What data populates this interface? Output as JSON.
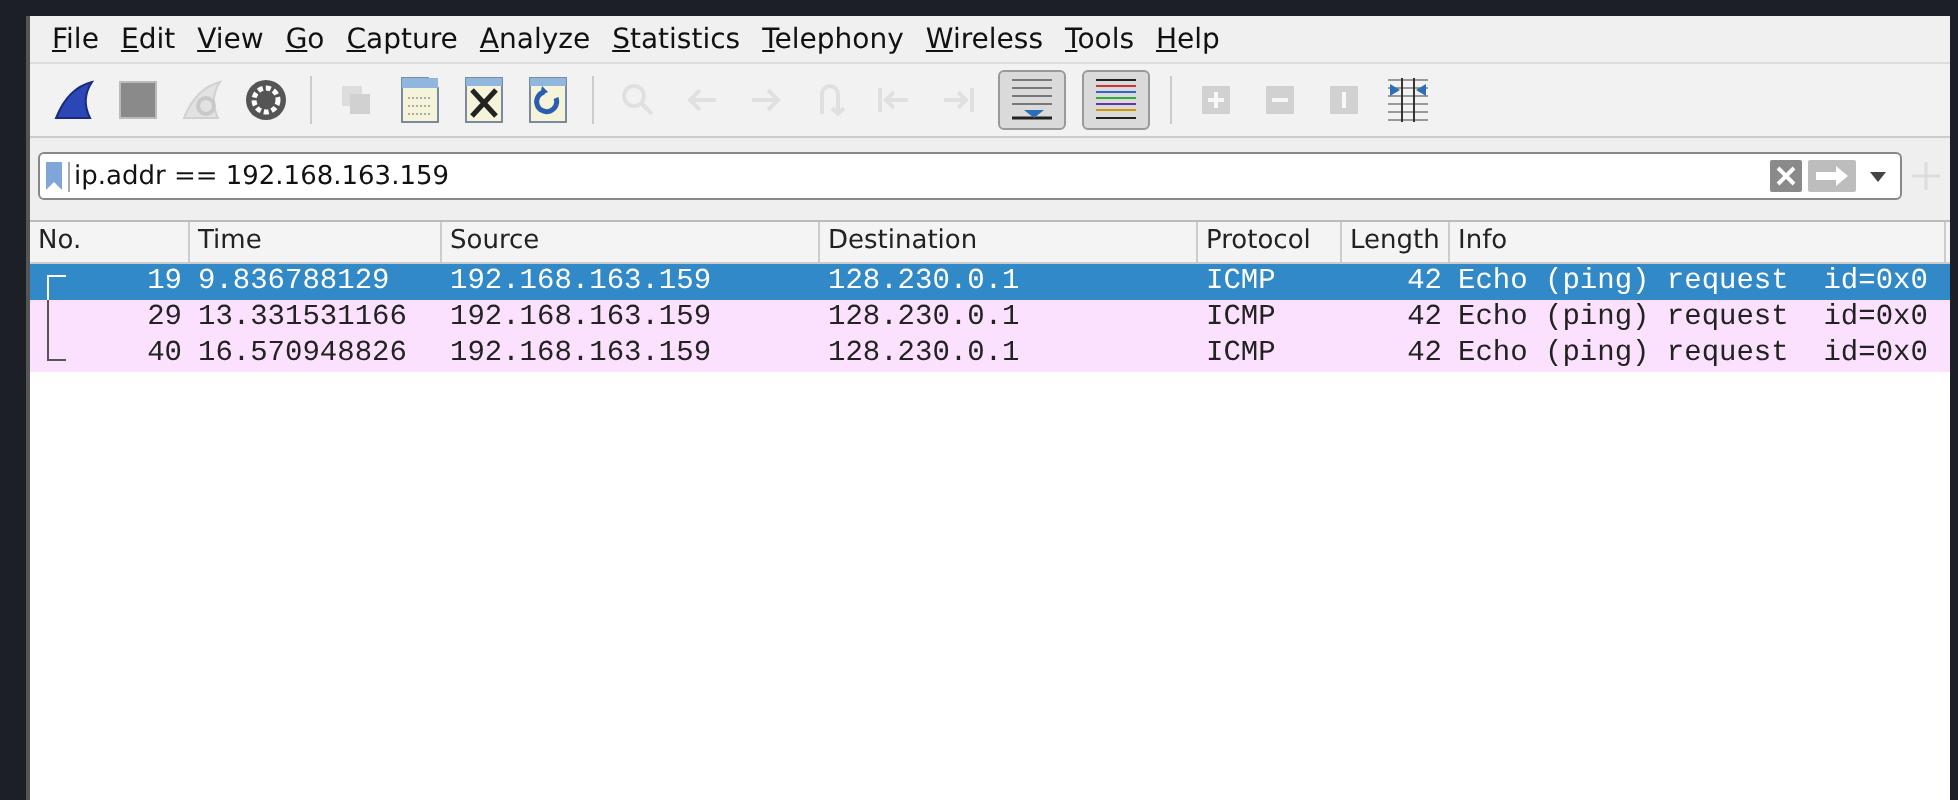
{
  "menu": [
    {
      "label": "File"
    },
    {
      "label": "Edit"
    },
    {
      "label": "View"
    },
    {
      "label": "Go"
    },
    {
      "label": "Capture"
    },
    {
      "label": "Analyze"
    },
    {
      "label": "Statistics"
    },
    {
      "label": "Telephony"
    },
    {
      "label": "Wireless"
    },
    {
      "label": "Tools"
    },
    {
      "label": "Help"
    }
  ],
  "toolbar_groups": [
    [
      {
        "kind": "start",
        "disabled": false,
        "pressed": false
      },
      {
        "kind": "stop",
        "disabled": false,
        "pressed": false
      },
      {
        "kind": "restart",
        "disabled": true,
        "pressed": false
      },
      {
        "kind": "options",
        "disabled": false,
        "pressed": false
      }
    ],
    [
      {
        "kind": "open",
        "disabled": true,
        "pressed": false
      },
      {
        "kind": "file",
        "disabled": false,
        "pressed": false
      },
      {
        "kind": "close",
        "disabled": false,
        "pressed": false
      },
      {
        "kind": "reload",
        "disabled": false,
        "pressed": false
      }
    ],
    [
      {
        "kind": "search",
        "disabled": true,
        "pressed": false
      },
      {
        "kind": "back",
        "disabled": true,
        "pressed": false
      },
      {
        "kind": "forward",
        "disabled": true,
        "pressed": false
      },
      {
        "kind": "goto",
        "disabled": true,
        "pressed": false
      },
      {
        "kind": "first",
        "disabled": true,
        "pressed": false
      },
      {
        "kind": "last",
        "disabled": true,
        "pressed": false
      },
      {
        "kind": "autoscroll",
        "disabled": false,
        "pressed": true
      },
      {
        "kind": "colorize",
        "disabled": false,
        "pressed": true
      }
    ],
    [
      {
        "kind": "zoom-in",
        "disabled": true,
        "pressed": false
      },
      {
        "kind": "zoom-out",
        "disabled": true,
        "pressed": false
      },
      {
        "kind": "zoom-reset",
        "disabled": true,
        "pressed": false
      },
      {
        "kind": "resize",
        "disabled": false,
        "pressed": false
      }
    ]
  ],
  "filter": {
    "value": "ip.addr == 192.168.163.159"
  },
  "table": {
    "columns": [
      "No.",
      "Time",
      "Source",
      "Destination",
      "Protocol",
      "Length",
      "Info"
    ],
    "rows": [
      {
        "selected": true,
        "cells": [
          "19",
          "9.836788129",
          "192.168.163.159",
          "128.230.0.1",
          "ICMP",
          "42",
          "Echo (ping) request  id=0x0"
        ]
      },
      {
        "selected": false,
        "cells": [
          "29",
          "13.331531166",
          "192.168.163.159",
          "128.230.0.1",
          "ICMP",
          "42",
          "Echo (ping) request  id=0x0"
        ]
      },
      {
        "selected": false,
        "cells": [
          "40",
          "16.570948826",
          "192.168.163.159",
          "128.230.0.1",
          "ICMP",
          "42",
          "Echo (ping) request  id=0x0"
        ]
      }
    ]
  }
}
